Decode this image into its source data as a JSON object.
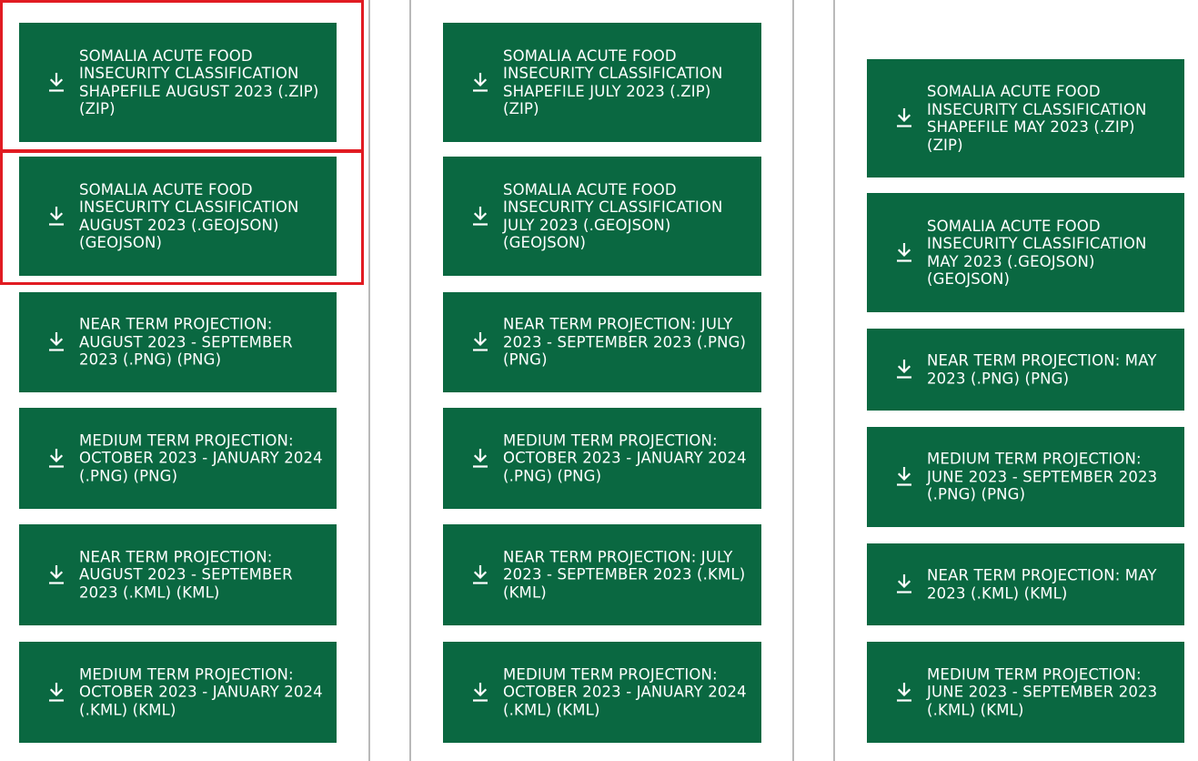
{
  "colors": {
    "accent": "#0a6841",
    "highlight": "#e11b22",
    "divider": "#b9b9b9",
    "text": "#ffffff"
  },
  "icon": "download-icon",
  "columns": [
    {
      "items": [
        {
          "label": "SOMALIA ACUTE FOOD INSECURITY CLASSIFICATION SHAPEFILE AUGUST 2023 (.ZIP) (ZIP)",
          "highlighted": true
        },
        {
          "label": "SOMALIA ACUTE FOOD INSECURITY CLASSIFICATION AUGUST 2023 (.GEOJSON) (GEOJSON)",
          "highlighted": true
        },
        {
          "label": "NEAR TERM PROJECTION: AUGUST 2023 - SEPTEMBER 2023 (.PNG) (PNG)",
          "highlighted": false
        },
        {
          "label": "MEDIUM TERM PROJECTION: OCTOBER 2023 - JANUARY 2024 (.PNG) (PNG)",
          "highlighted": false
        },
        {
          "label": "NEAR TERM PROJECTION: AUGUST 2023 - SEPTEMBER 2023 (.KML) (KML)",
          "highlighted": false
        },
        {
          "label": "MEDIUM TERM PROJECTION: OCTOBER 2023 - JANUARY 2024 (.KML) (KML)",
          "highlighted": false
        }
      ]
    },
    {
      "items": [
        {
          "label": "SOMALIA ACUTE FOOD INSECURITY CLASSIFICATION SHAPEFILE JULY 2023 (.ZIP) (ZIP)",
          "highlighted": false
        },
        {
          "label": "SOMALIA ACUTE FOOD INSECURITY CLASSIFICATION JULY 2023 (.GEOJSON) (GEOJSON)",
          "highlighted": false
        },
        {
          "label": "NEAR TERM PROJECTION: JULY 2023 - SEPTEMBER 2023 (.PNG) (PNG)",
          "highlighted": false
        },
        {
          "label": "MEDIUM TERM PROJECTION: OCTOBER 2023 - JANUARY 2024 (.PNG) (PNG)",
          "highlighted": false
        },
        {
          "label": "NEAR TERM PROJECTION: JULY 2023 - SEPTEMBER 2023 (.KML) (KML)",
          "highlighted": false
        },
        {
          "label": "MEDIUM TERM PROJECTION: OCTOBER 2023 - JANUARY 2024 (.KML) (KML)",
          "highlighted": false
        }
      ]
    },
    {
      "items": [
        {
          "label": "SOMALIA ACUTE FOOD INSECURITY CLASSIFICATION SHAPEFILE MAY 2023 (.ZIP) (ZIP)",
          "highlighted": false
        },
        {
          "label": "SOMALIA ACUTE FOOD INSECURITY CLASSIFICATION MAY 2023 (.GEOJSON) (GEOJSON)",
          "highlighted": false
        },
        {
          "label": "NEAR TERM PROJECTION: MAY 2023 (.PNG) (PNG)",
          "highlighted": false
        },
        {
          "label": "MEDIUM TERM PROJECTION: JUNE 2023 - SEPTEMBER 2023 (.PNG) (PNG)",
          "highlighted": false
        },
        {
          "label": "NEAR TERM PROJECTION: MAY 2023 (.KML) (KML)",
          "highlighted": false
        },
        {
          "label": "MEDIUM TERM PROJECTION: JUNE 2023 - SEPTEMBER 2023 (.KML) (KML)",
          "highlighted": false
        }
      ]
    }
  ]
}
